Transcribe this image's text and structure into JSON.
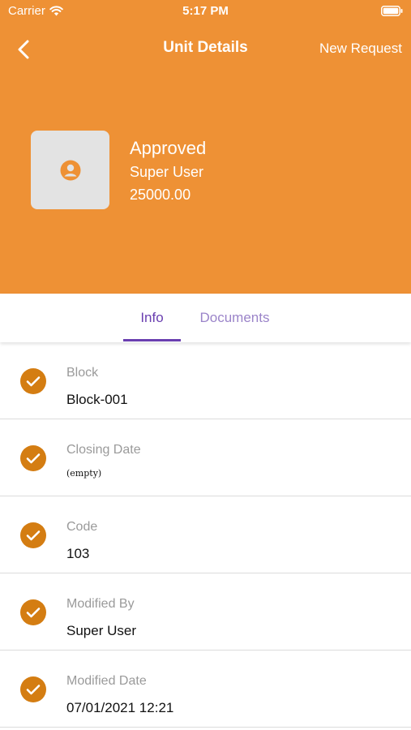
{
  "status_bar": {
    "carrier": "Carrier",
    "time": "5:17 PM"
  },
  "nav": {
    "title": "Unit Details",
    "action": "New Request"
  },
  "unit": {
    "status": "Approved",
    "user": "Super User",
    "amount": "25000.00"
  },
  "tabs": [
    {
      "label": "Info",
      "active": true
    },
    {
      "label": "Documents",
      "active": false
    }
  ],
  "fields": [
    {
      "label": "Block",
      "value": "Block-001"
    },
    {
      "label": "Closing Date",
      "value": "(empty)"
    },
    {
      "label": "Code",
      "value": "103"
    },
    {
      "label": "Modified By",
      "value": "Super User"
    },
    {
      "label": "Modified Date",
      "value": "07/01/2021 12:21"
    }
  ],
  "colors": {
    "header_bg": "#ee9135",
    "check_bg": "#d47d12",
    "tab_active": "#6a3fb0",
    "tab_inactive": "#9b84c9"
  },
  "icons": [
    "wifi-icon",
    "battery-icon",
    "back-chevron-icon",
    "user-avatar-icon",
    "check-icon"
  ]
}
